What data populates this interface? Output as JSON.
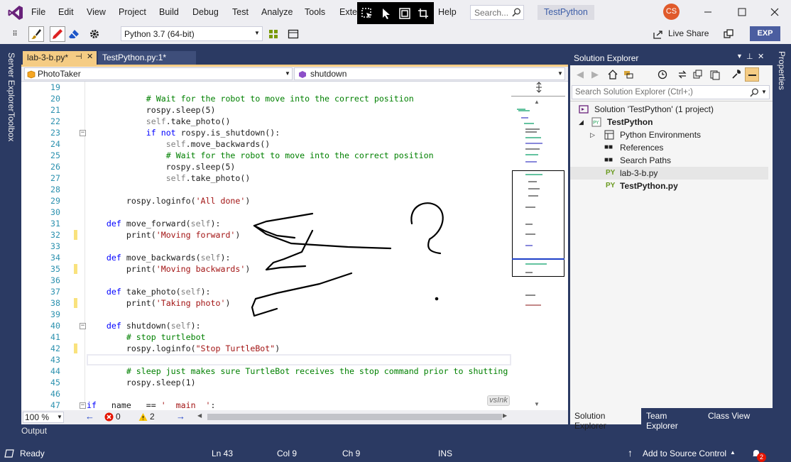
{
  "menubar": {
    "items": [
      "File",
      "Edit",
      "View",
      "Project",
      "Build",
      "Debug",
      "Test",
      "Analyze",
      "Tools",
      "Exte",
      "Help"
    ],
    "search_placeholder": "Search...",
    "solution_name": "TestPython",
    "user_initials": "CS"
  },
  "toolbar": {
    "env_select": "Python 3.7 (64-bit)",
    "live_share": "Live Share",
    "exp_badge": "EXP"
  },
  "left_tabs": [
    "Server Explorer",
    "Toolbox"
  ],
  "right_tabs": [
    "Properties"
  ],
  "editor": {
    "tabs": [
      {
        "label": "lab-3-b.py*",
        "active": true
      },
      {
        "label": "TestPython.py:1*",
        "active": false
      }
    ],
    "nav_left": "PhotoTaker",
    "nav_right": "shutdown",
    "zoom": "100 %",
    "errors": "0",
    "warnings": "2",
    "watermark": "vsInk",
    "lines": [
      {
        "n": "19",
        "t": ""
      },
      {
        "n": "20",
        "t": "            # Wait for the robot to move into the correct position"
      },
      {
        "n": "21",
        "t": "            rospy.sleep(5)"
      },
      {
        "n": "22",
        "t": "            self.take_photo()"
      },
      {
        "n": "23",
        "t": "            if not rospy.is_shutdown():"
      },
      {
        "n": "24",
        "t": "                self.move_backwards()"
      },
      {
        "n": "25",
        "t": "                # Wait for the robot to move into the correct position"
      },
      {
        "n": "26",
        "t": "                rospy.sleep(5)"
      },
      {
        "n": "27",
        "t": "                self.take_photo()"
      },
      {
        "n": "28",
        "t": ""
      },
      {
        "n": "29",
        "t": "        rospy.loginfo('All done')"
      },
      {
        "n": "30",
        "t": ""
      },
      {
        "n": "31",
        "t": "    def move_forward(self):"
      },
      {
        "n": "32",
        "t": "        print('Moving forward')"
      },
      {
        "n": "33",
        "t": ""
      },
      {
        "n": "34",
        "t": "    def move_backwards(self):"
      },
      {
        "n": "35",
        "t": "        print('Moving backwards')"
      },
      {
        "n": "36",
        "t": ""
      },
      {
        "n": "37",
        "t": "    def take_photo(self):"
      },
      {
        "n": "38",
        "t": "        print('Taking photo')"
      },
      {
        "n": "39",
        "t": ""
      },
      {
        "n": "40",
        "t": "    def shutdown(self):"
      },
      {
        "n": "41",
        "t": "        # stop turtlebot"
      },
      {
        "n": "42",
        "t": "        rospy.loginfo(\"Stop TurtleBot\")"
      },
      {
        "n": "43",
        "t": ""
      },
      {
        "n": "44",
        "t": "        # sleep just makes sure TurtleBot receives the stop command prior to shutting"
      },
      {
        "n": "45",
        "t": "        rospy.sleep(1)"
      },
      {
        "n": "46",
        "t": ""
      },
      {
        "n": "47",
        "t": "if __name__ == '__main__':"
      }
    ]
  },
  "solution_explorer": {
    "title": "Solution Explorer",
    "search_placeholder": "Search Solution Explorer (Ctrl+;)",
    "items": [
      {
        "label": "Solution 'TestPython' (1 project)",
        "bold": false
      },
      {
        "label": "TestPython",
        "bold": true
      },
      {
        "label": "Python Environments",
        "bold": false
      },
      {
        "label": "References",
        "bold": false
      },
      {
        "label": "Search Paths",
        "bold": false
      },
      {
        "label": "lab-3-b.py",
        "bold": false
      },
      {
        "label": "TestPython.py",
        "bold": true
      }
    ],
    "bottom_tabs": [
      "Solution Explorer",
      "Team Explorer",
      "Class View"
    ]
  },
  "output": {
    "label": "Output"
  },
  "status": {
    "ready": "Ready",
    "ln": "Ln 43",
    "col": "Col 9",
    "ch": "Ch 9",
    "ins": "INS",
    "source_control": "Add to Source Control",
    "notifications": "2"
  },
  "colors": {
    "accent": "#2b3a63",
    "vs_purple": "#68217a",
    "keyword": "#0000ff",
    "comment": "#008000",
    "string": "#a31515",
    "linenum": "#2b91af"
  }
}
